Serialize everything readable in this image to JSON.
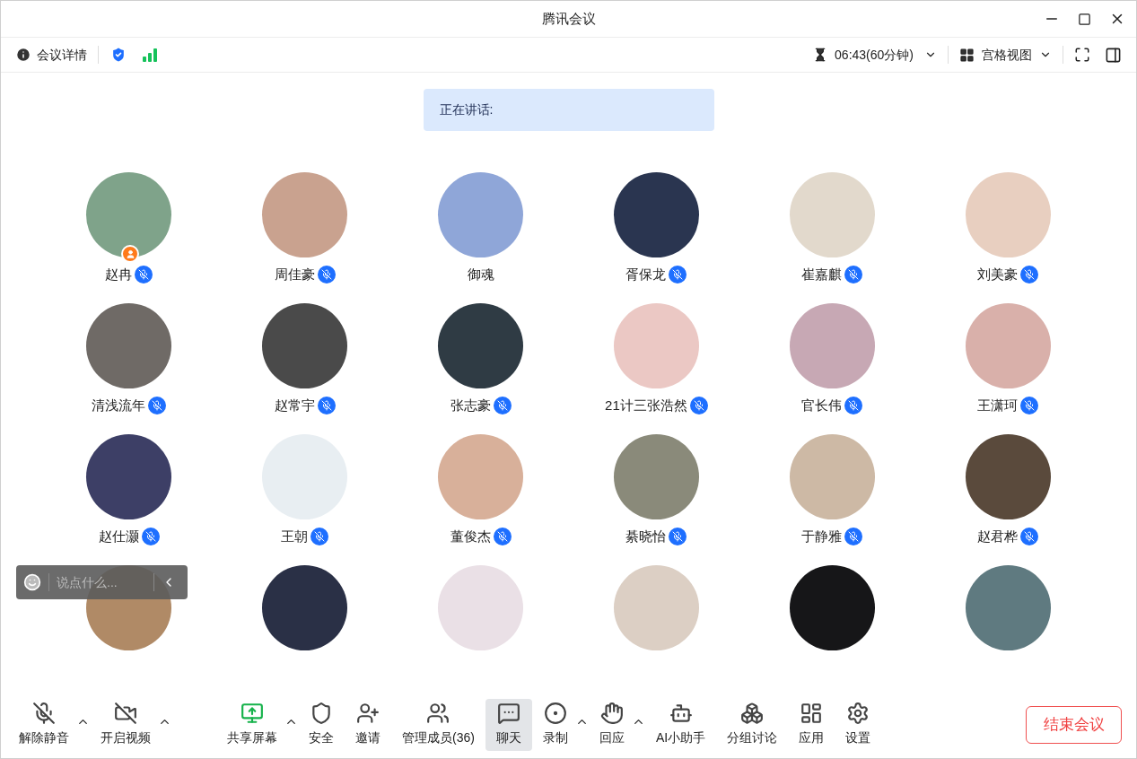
{
  "window": {
    "title": "腾讯会议"
  },
  "info_bar": {
    "details": "会议详情",
    "timer": "06:43(60分钟)",
    "view": "宫格视图"
  },
  "speaking": {
    "label": "正在讲话:"
  },
  "participants": [
    {
      "name": "赵冉",
      "host": true,
      "muted": true,
      "color": "#7fa38a"
    },
    {
      "name": "周佳豪",
      "host": false,
      "muted": true,
      "color": "#c9a28f"
    },
    {
      "name": "御魂",
      "host": false,
      "muted": false,
      "color": "#8fa6d8"
    },
    {
      "name": "胥保龙",
      "host": false,
      "muted": true,
      "color": "#2a3550"
    },
    {
      "name": "崔嘉麒",
      "host": false,
      "muted": true,
      "color": "#e2d9cc"
    },
    {
      "name": "刘美豪",
      "host": false,
      "muted": true,
      "color": "#e8cfc0"
    },
    {
      "name": "清浅流年",
      "host": false,
      "muted": true,
      "color": "#6f6a66"
    },
    {
      "name": "赵常宇",
      "host": false,
      "muted": true,
      "color": "#4a4a4a"
    },
    {
      "name": "张志豪",
      "host": false,
      "muted": true,
      "color": "#2f3b44"
    },
    {
      "name": "21计三张浩然",
      "host": false,
      "muted": true,
      "color": "#ebc8c4"
    },
    {
      "name": "官长伟",
      "host": false,
      "muted": true,
      "color": "#c7a8b4"
    },
    {
      "name": "王潇珂",
      "host": false,
      "muted": true,
      "color": "#d9b0aa"
    },
    {
      "name": "赵仕灏",
      "host": false,
      "muted": true,
      "color": "#3d3f66"
    },
    {
      "name": "王朝",
      "host": false,
      "muted": true,
      "color": "#e8eef2"
    },
    {
      "name": "董俊杰",
      "host": false,
      "muted": true,
      "color": "#d8b09a"
    },
    {
      "name": "綦晓怡",
      "host": false,
      "muted": true,
      "color": "#8a8a7a"
    },
    {
      "name": "于静雅",
      "host": false,
      "muted": true,
      "color": "#cdb9a5"
    },
    {
      "name": "赵君桦",
      "host": false,
      "muted": true,
      "color": "#5a4a3c"
    }
  ],
  "cut_off_tiles": [
    {
      "color": "#b08a66"
    },
    {
      "color": "#2a3046"
    },
    {
      "color": "#eae0e6"
    },
    {
      "color": "#dccfc4"
    },
    {
      "color": "#161618"
    },
    {
      "color": "#5f7a80"
    }
  ],
  "chat_input": {
    "placeholder": "说点什么..."
  },
  "toolbar": [
    {
      "kind": "mic",
      "label": "解除静音",
      "caret": true,
      "selected": false
    },
    {
      "kind": "video",
      "label": "开启视频",
      "caret": true,
      "selected": false
    },
    {
      "kind": "share",
      "label": "共享屏幕",
      "caret": true,
      "selected": false
    },
    {
      "kind": "security",
      "label": "安全",
      "caret": false,
      "selected": false
    },
    {
      "kind": "invite",
      "label": "邀请",
      "caret": false,
      "selected": false
    },
    {
      "kind": "members",
      "label": "管理成员(36)",
      "caret": false,
      "selected": false
    },
    {
      "kind": "chat",
      "label": "聊天",
      "caret": false,
      "selected": true
    },
    {
      "kind": "record",
      "label": "录制",
      "caret": true,
      "selected": false
    },
    {
      "kind": "react",
      "label": "回应",
      "caret": true,
      "selected": false
    },
    {
      "kind": "ai",
      "label": "AI小助手",
      "caret": false,
      "selected": false
    },
    {
      "kind": "breakout",
      "label": "分组讨论",
      "caret": false,
      "selected": false
    },
    {
      "kind": "apps",
      "label": "应用",
      "caret": false,
      "selected": false
    },
    {
      "kind": "settings",
      "label": "设置",
      "caret": false,
      "selected": false
    }
  ],
  "end_button": "结束会议"
}
